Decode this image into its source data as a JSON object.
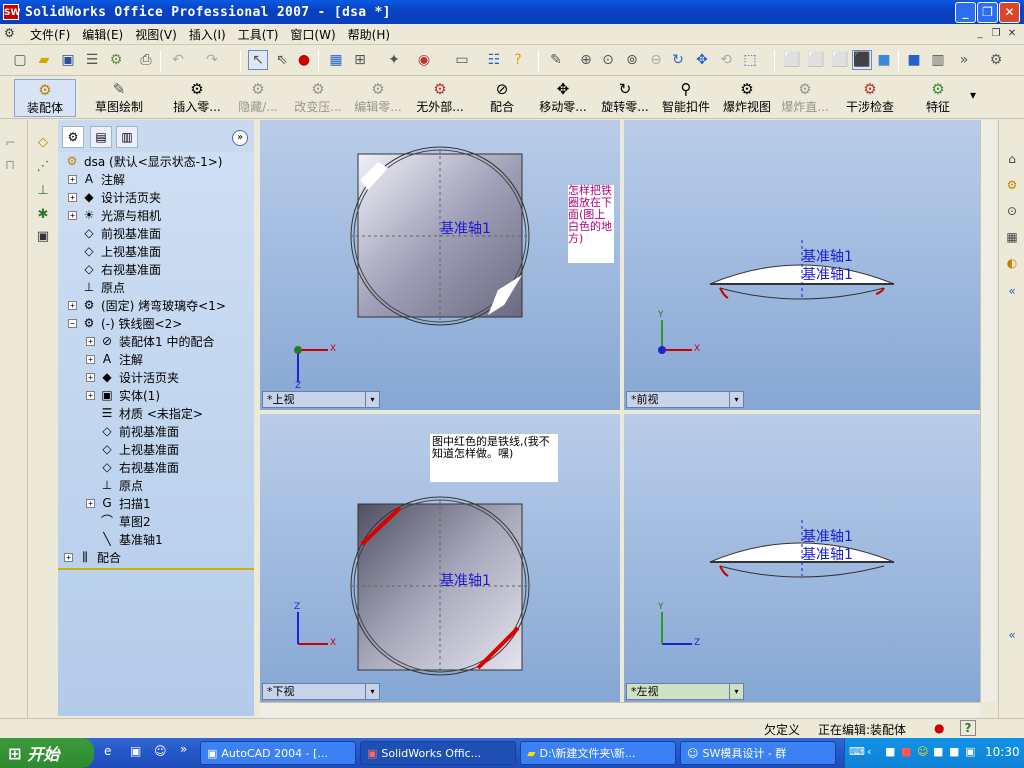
{
  "window": {
    "title": "SolidWorks Office Professional 2007 - [dsa *]",
    "app_icon": "SW",
    "controls": [
      "_",
      "❐",
      "✕"
    ]
  },
  "menu": {
    "items": [
      "文件(F)",
      "编辑(E)",
      "视图(V)",
      "插入(I)",
      "工具(T)",
      "窗口(W)",
      "帮助(H)"
    ]
  },
  "command_manager": {
    "groups": [
      {
        "label": "装配体",
        "icon": "assembly-icon"
      },
      {
        "label": "草图绘制",
        "icon": "sketch-icon"
      }
    ],
    "commands": [
      {
        "label": "插入零...",
        "disabled": false
      },
      {
        "label": "隐藏/...",
        "disabled": true
      },
      {
        "label": "改变压...",
        "disabled": true
      },
      {
        "label": "编辑零...",
        "disabled": true
      },
      {
        "label": "无外部...",
        "disabled": false
      },
      {
        "label": "配合",
        "disabled": false
      },
      {
        "label": "移动零...",
        "disabled": false
      },
      {
        "label": "旋转零...",
        "disabled": false
      },
      {
        "label": "智能扣件",
        "disabled": false
      },
      {
        "label": "爆炸视图",
        "disabled": false
      },
      {
        "label": "爆炸直...",
        "disabled": true
      },
      {
        "label": "干涉检查",
        "disabled": false
      },
      {
        "label": "特征",
        "disabled": false
      }
    ]
  },
  "feature_tree": {
    "root": "dsa  (默认<显示状态-1>)",
    "nodes": [
      {
        "label": "注解",
        "expander": "+",
        "icon": "A"
      },
      {
        "label": "设计活页夹",
        "expander": "+",
        "icon": "◆"
      },
      {
        "label": "光源与相机",
        "expander": "+",
        "icon": "☀"
      },
      {
        "label": "前视基准面",
        "expander": "",
        "icon": "◇"
      },
      {
        "label": "上视基准面",
        "expander": "",
        "icon": "◇"
      },
      {
        "label": "右视基准面",
        "expander": "",
        "icon": "◇"
      },
      {
        "label": "原点",
        "expander": "",
        "icon": "⊥"
      },
      {
        "label": "(固定) 烤弯玻璃夺<1>",
        "expander": "+",
        "icon": "⚙"
      },
      {
        "label": "(-) 铁线圈<2>",
        "expander": "−",
        "icon": "⚙"
      }
    ],
    "children": [
      {
        "label": "装配体1 中的配合",
        "expander": "+",
        "icon": "⊘"
      },
      {
        "label": "注解",
        "expander": "+",
        "icon": "A"
      },
      {
        "label": "设计活页夹",
        "expander": "+",
        "icon": "◆"
      },
      {
        "label": "实体(1)",
        "expander": "+",
        "icon": "▣"
      },
      {
        "label": "材质 <未指定>",
        "expander": "",
        "icon": "☰"
      },
      {
        "label": "前视基准面",
        "expander": "",
        "icon": "◇"
      },
      {
        "label": "上视基准面",
        "expander": "",
        "icon": "◇"
      },
      {
        "label": "右视基准面",
        "expander": "",
        "icon": "◇"
      },
      {
        "label": "原点",
        "expander": "",
        "icon": "⊥"
      },
      {
        "label": "扫描1",
        "expander": "+",
        "icon": "G"
      },
      {
        "label": "草图2",
        "expander": "",
        "icon": "⌒"
      },
      {
        "label": "基准轴1",
        "expander": "",
        "icon": "╲"
      }
    ],
    "tail": {
      "label": "配合",
      "expander": "+",
      "icon": "⫼"
    }
  },
  "viewports": {
    "top": {
      "label": "*上视",
      "axis_label": "基准轴1"
    },
    "front": {
      "label": "*前视",
      "axis_labels": [
        "基准轴1",
        "基准轴1"
      ]
    },
    "bottom": {
      "label": "*下视",
      "axis_label": "基准轴1"
    },
    "left": {
      "label": "*左视",
      "axis_labels": [
        "基准轴1",
        "基准轴1"
      ]
    }
  },
  "annotations": {
    "question": "怎样把铁圈放在下面(图上白色的地方)",
    "note": "图中红色的是铁线,(我不知道怎样做。嘿)"
  },
  "axes": {
    "x": "X",
    "y": "Y",
    "z": "Z"
  },
  "statusbar": {
    "state": "欠定义",
    "mode": "正在编辑:装配体",
    "help": "?"
  },
  "taskbar": {
    "start": "开始",
    "tasks": [
      {
        "label": "AutoCAD 2004 - [...",
        "active": false
      },
      {
        "label": "SolidWorks Offic...",
        "active": true
      },
      {
        "label": "D:\\新建文件夹\\新...",
        "active": false
      },
      {
        "label": "SW模具设计 - 群",
        "active": false
      }
    ],
    "clock": "10:30"
  },
  "colors": {
    "titlebar": "#0842c5",
    "wire": "#cc0000",
    "axis_blue": "#1a1ad0",
    "note_magenta": "#b0007a"
  }
}
